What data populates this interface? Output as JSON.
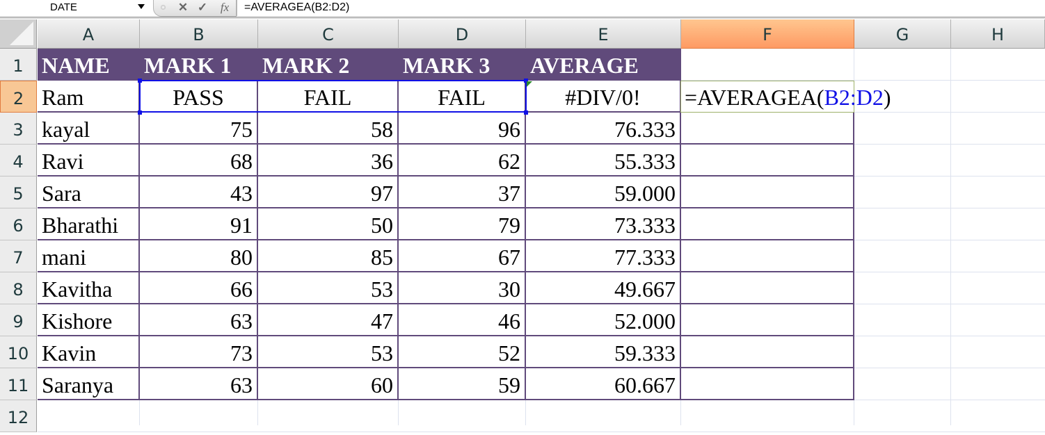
{
  "formula_bar": {
    "name_box": "DATE",
    "name_box_dropdown_icon": "triangle-down-icon",
    "cancel_icon": "✕",
    "enter_icon": "✓",
    "function_icon": "fx",
    "formula": "=AVERAGEA(B2:D2)"
  },
  "columns": [
    "A",
    "B",
    "C",
    "D",
    "E",
    "F",
    "G",
    "H"
  ],
  "selected_column": "F",
  "rows": [
    "1",
    "2",
    "3",
    "4",
    "5",
    "6",
    "7",
    "8",
    "9",
    "10",
    "11",
    "12"
  ],
  "selected_row": "2",
  "table": {
    "headers": [
      "NAME",
      "MARK 1",
      "MARK 2",
      "MARK 3",
      "AVERAGE"
    ],
    "header_color": "#604a7b",
    "rows": [
      [
        "Ram",
        "PASS",
        "FAIL",
        "FAIL",
        "#DIV/0!"
      ],
      [
        "kayal",
        "75",
        "58",
        "96",
        "76.333"
      ],
      [
        "Ravi",
        "68",
        "36",
        "62",
        "55.333"
      ],
      [
        "Sara",
        "43",
        "97",
        "37",
        "59.000"
      ],
      [
        "Bharathi",
        "91",
        "50",
        "79",
        "73.333"
      ],
      [
        "mani",
        "80",
        "85",
        "67",
        "77.333"
      ],
      [
        "Kavitha",
        "66",
        "53",
        "30",
        "49.667"
      ],
      [
        "Kishore",
        "63",
        "47",
        "46",
        "52.000"
      ],
      [
        "Kavin",
        "73",
        "53",
        "52",
        "59.333"
      ],
      [
        "Saranya",
        "63",
        "60",
        "59",
        "60.667"
      ]
    ]
  },
  "editing_cell": {
    "address": "F2",
    "prefix": "=AVERAGEA(",
    "reference": "B2:D2",
    "suffix": ")",
    "reference_color": "#1010e6"
  }
}
